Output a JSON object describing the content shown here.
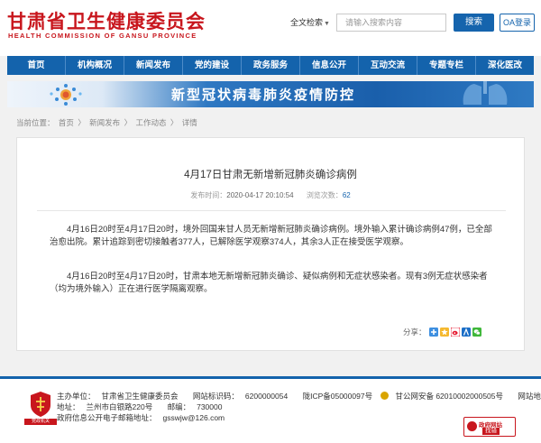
{
  "header": {
    "site_title": "甘肃省卫生健康委员会",
    "site_subtitle": "HEALTH COMMISSION OF GANSU PROVINCE",
    "search_scope": "全文检索",
    "search_placeholder": "请输入搜索内容",
    "search_button": "搜索",
    "oa_button": "OA登录"
  },
  "nav": {
    "items": [
      "首页",
      "机构概况",
      "新闻发布",
      "党的建设",
      "政务服务",
      "信息公开",
      "互动交流",
      "专题专栏",
      "深化医改"
    ]
  },
  "banner": {
    "title": "新型冠状病毒肺炎疫情防控"
  },
  "breadcrumb": {
    "prefix": "当前位置：",
    "items": [
      "首页",
      "新闻发布",
      "工作动态",
      "详情"
    ],
    "separator": "〉"
  },
  "article": {
    "title": "4月17日甘肃无新增新冠肺炎确诊病例",
    "publish_label": "发布时间：",
    "publish_time": "2020-04-17 20:10:54",
    "views_label": "浏览次数：",
    "views": "62",
    "paragraphs": [
      "4月16日20时至4月17日20时，境外回国来甘人员无新增新冠肺炎确诊病例。境外输入累计确诊病例47例，已全部治愈出院。累计追踪到密切接触者377人，已解除医学观察374人，其余3人正在接受医学观察。",
      "4月16日20时至4月17日20时，甘肃本地无新增新冠肺炎确诊、疑似病例和无症状感染者。现有3例无症状感染者（均为境外输入）正在进行医学隔离观察。"
    ],
    "share_label": "分享："
  },
  "footer": {
    "emblem_label": "党政机关",
    "host_label": "主办单位：",
    "host": "甘肃省卫生健康委员会",
    "site_id_label": "网站标识码：",
    "site_id": "6200000054",
    "icp": "陇ICP备05000097号",
    "police": "甘公网安备 62010002000505号",
    "sitemap": "网站地图",
    "address_label": "地址：",
    "address": "兰州市白银路220号",
    "postcode_label": "邮编：",
    "postcode": "730000",
    "email_label": "政府信息公开电子邮箱地址：",
    "email": "gsswjw@126.com",
    "gov_badge_line1": "政府网站",
    "gov_badge_line2": "找错"
  },
  "colors": {
    "brand_red": "#c8161d",
    "nav_blue": "#1463ac",
    "button_blue": "#1564ad"
  },
  "icons": {
    "share": [
      "plus-icon",
      "qzone-icon",
      "weibo-icon",
      "renren-icon",
      "wechat-icon"
    ]
  }
}
